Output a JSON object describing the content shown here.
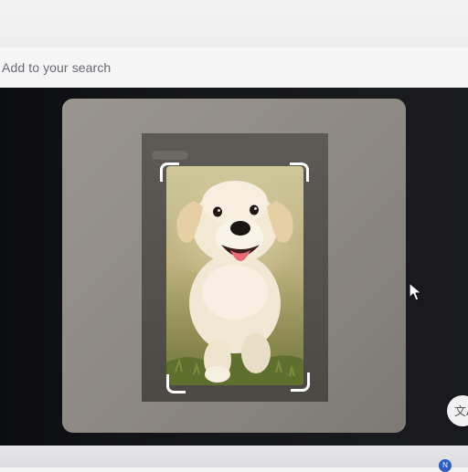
{
  "search": {
    "label": "Add to your search"
  },
  "lens": {
    "subject_icon": "puppy-image",
    "translate_icon": "translate-icon",
    "translate_glyph": "文A"
  },
  "taskbar": {
    "badge": "N"
  },
  "colors": {
    "panel": "#8f8a84",
    "crop_handles": "#ffffff",
    "background_dark": "#141518"
  }
}
